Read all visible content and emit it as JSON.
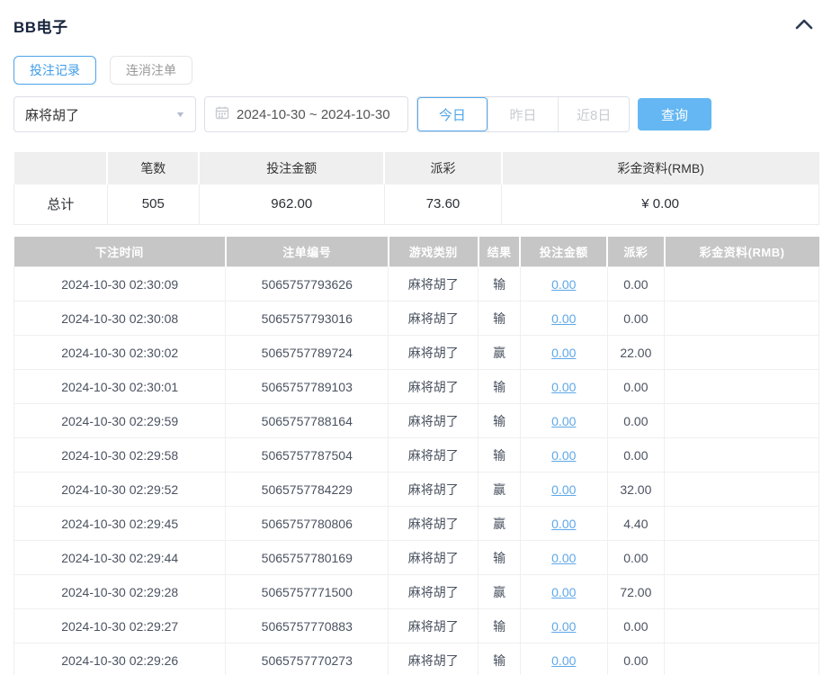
{
  "header": {
    "title": "BB电子"
  },
  "tabs": [
    {
      "label": "投注记录",
      "active": true
    },
    {
      "label": "连消注单",
      "active": false
    }
  ],
  "filters": {
    "game_select": {
      "value": "麻将胡了"
    },
    "date_range": {
      "value": "2024-10-30 ~ 2024-10-30"
    },
    "quick_buttons": [
      {
        "label": "今日",
        "active": true
      },
      {
        "label": "昨日",
        "active": false
      },
      {
        "label": "近8日",
        "active": false
      }
    ],
    "query_label": "查询"
  },
  "summary": {
    "headers": [
      "",
      "笔数",
      "投注金额",
      "派彩",
      "彩金资料(RMB)"
    ],
    "row": {
      "label": "总计",
      "count": "505",
      "bet_amount": "962.00",
      "payout": "73.60",
      "bonus": "¥ 0.00"
    }
  },
  "table": {
    "headers": [
      "下注时间",
      "注单编号",
      "游戏类别",
      "结果",
      "投注金额",
      "派彩",
      "彩金资料(RMB)"
    ],
    "rows": [
      {
        "time": "2024-10-30 02:30:09",
        "ticket": "5065757793626",
        "game": "麻将胡了",
        "result": "输",
        "bet": "0.00",
        "payout": "0.00",
        "bonus": ""
      },
      {
        "time": "2024-10-30 02:30:08",
        "ticket": "5065757793016",
        "game": "麻将胡了",
        "result": "输",
        "bet": "0.00",
        "payout": "0.00",
        "bonus": ""
      },
      {
        "time": "2024-10-30 02:30:02",
        "ticket": "5065757789724",
        "game": "麻将胡了",
        "result": "赢",
        "bet": "0.00",
        "payout": "22.00",
        "bonus": ""
      },
      {
        "time": "2024-10-30 02:30:01",
        "ticket": "5065757789103",
        "game": "麻将胡了",
        "result": "输",
        "bet": "0.00",
        "payout": "0.00",
        "bonus": ""
      },
      {
        "time": "2024-10-30 02:29:59",
        "ticket": "5065757788164",
        "game": "麻将胡了",
        "result": "输",
        "bet": "0.00",
        "payout": "0.00",
        "bonus": ""
      },
      {
        "time": "2024-10-30 02:29:58",
        "ticket": "5065757787504",
        "game": "麻将胡了",
        "result": "输",
        "bet": "0.00",
        "payout": "0.00",
        "bonus": ""
      },
      {
        "time": "2024-10-30 02:29:52",
        "ticket": "5065757784229",
        "game": "麻将胡了",
        "result": "赢",
        "bet": "0.00",
        "payout": "32.00",
        "bonus": ""
      },
      {
        "time": "2024-10-30 02:29:45",
        "ticket": "5065757780806",
        "game": "麻将胡了",
        "result": "赢",
        "bet": "0.00",
        "payout": "4.40",
        "bonus": ""
      },
      {
        "time": "2024-10-30 02:29:44",
        "ticket": "5065757780169",
        "game": "麻将胡了",
        "result": "输",
        "bet": "0.00",
        "payout": "0.00",
        "bonus": ""
      },
      {
        "time": "2024-10-30 02:29:28",
        "ticket": "5065757771500",
        "game": "麻将胡了",
        "result": "赢",
        "bet": "0.00",
        "payout": "72.00",
        "bonus": ""
      },
      {
        "time": "2024-10-30 02:29:27",
        "ticket": "5065757770883",
        "game": "麻将胡了",
        "result": "输",
        "bet": "0.00",
        "payout": "0.00",
        "bonus": ""
      },
      {
        "time": "2024-10-30 02:29:26",
        "ticket": "5065757770273",
        "game": "麻将胡了",
        "result": "输",
        "bet": "0.00",
        "payout": "0.00",
        "bonus": ""
      }
    ]
  },
  "colors": {
    "accent_blue": "#57a9ec",
    "query_button_blue": "#64b7f3",
    "link_blue": "#5fa8e8",
    "table_header_gray": "#c6c6c6",
    "summary_header_gray": "#efeff0",
    "title_navy": "#17233d"
  }
}
